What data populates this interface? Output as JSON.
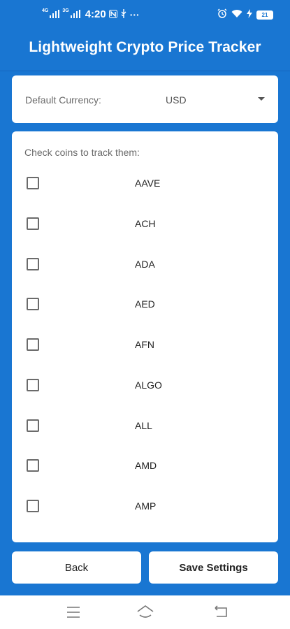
{
  "status_bar": {
    "network_1": "4G",
    "network_2": "3G",
    "time": "4:20",
    "more": "···",
    "battery_level": "21"
  },
  "app": {
    "title": "Lightweight Crypto Price Tracker"
  },
  "currency": {
    "label": "Default Currency:",
    "value": "USD"
  },
  "coins": {
    "heading": "Check coins to track them:",
    "items": [
      {
        "label": "AAVE",
        "checked": false
      },
      {
        "label": "ACH",
        "checked": false
      },
      {
        "label": "ADA",
        "checked": false
      },
      {
        "label": "AED",
        "checked": false
      },
      {
        "label": "AFN",
        "checked": false
      },
      {
        "label": "ALGO",
        "checked": false
      },
      {
        "label": "ALL",
        "checked": false
      },
      {
        "label": "AMD",
        "checked": false
      },
      {
        "label": "AMP",
        "checked": false
      }
    ]
  },
  "actions": {
    "back_label": "Back",
    "save_label": "Save Settings"
  },
  "navigation": {
    "menu_icon": "menu-icon",
    "home_icon": "home-icon",
    "back_icon": "back-icon"
  },
  "colors": {
    "primary": "#1976D2",
    "card": "#FFFFFF"
  }
}
